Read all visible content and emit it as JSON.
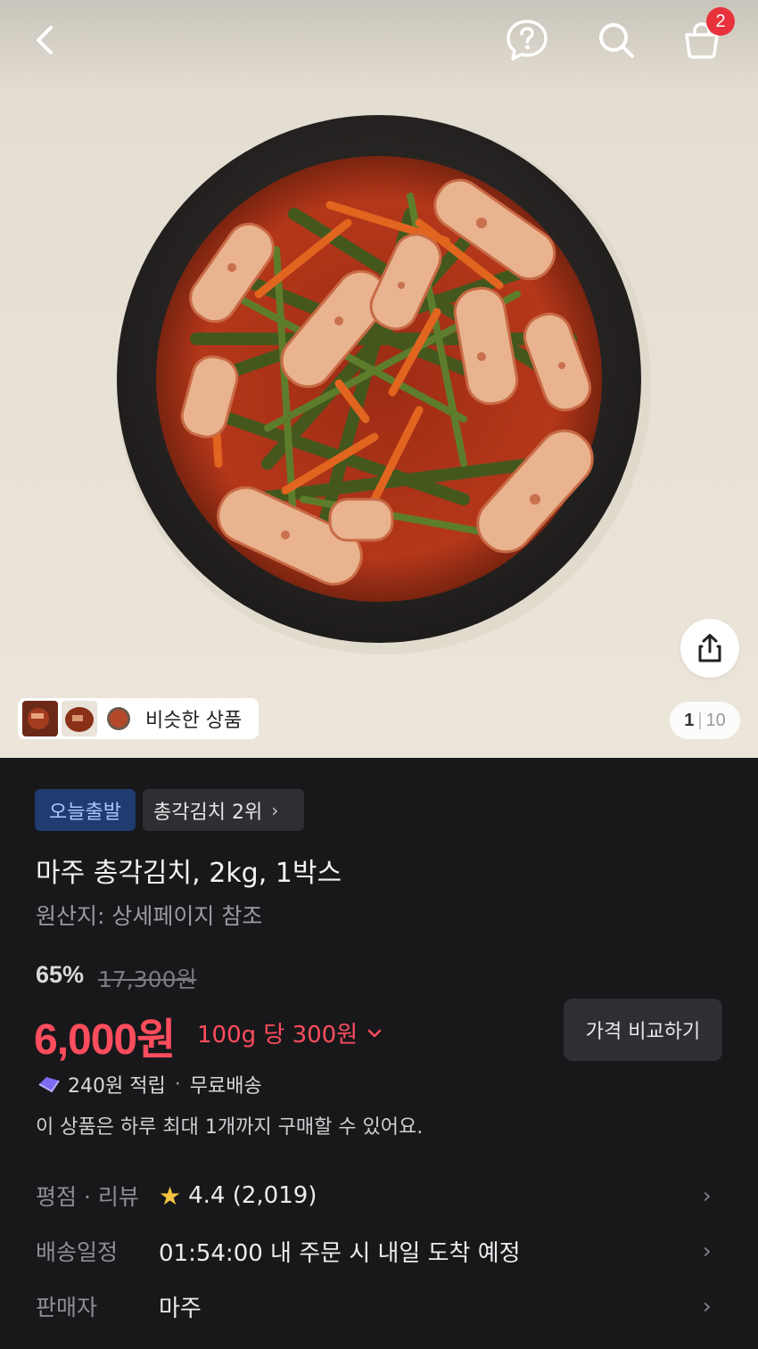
{
  "header": {
    "cart_count": "2"
  },
  "hero": {
    "similar_label": "비슷한 상품",
    "counter_current": "1",
    "counter_total": "10"
  },
  "product": {
    "tag_today": "오늘출발",
    "tag_rank": "총각김치 2위",
    "title": "마주 총각김치, 2kg, 1박스",
    "origin": "원산지: 상세페이지 참조",
    "discount": "65%",
    "original_price": "17,300원",
    "price": "6,000원",
    "unit_price": "100g 당 300원",
    "compare_label": "가격 비교하기",
    "reward": "240원 적립",
    "shipping": "무료배송",
    "limit_notice": "이 상품은 하루 최대 1개까지 구매할 수 있어요."
  },
  "info_rows": {
    "rating_key": "평점 · 리뷰",
    "rating_value": "4.4 (2,019)",
    "ship_key": "배송일정",
    "ship_value": "01:54:00 내 주문 시 내일 도착 예정",
    "seller_key": "판매자",
    "seller_value": "마주"
  },
  "colors": {
    "accent_price": "#ff4d5d",
    "badge_red": "#e8323c",
    "today_tag_bg": "#1f3b70",
    "panel_bg": "#18181b",
    "star": "#f6c343"
  },
  "icons": [
    "back-arrow-icon",
    "help-icon",
    "search-icon",
    "cart-icon",
    "share-icon",
    "reward-coin-icon",
    "star-icon",
    "chevron-right-icon",
    "chevron-down-icon"
  ]
}
